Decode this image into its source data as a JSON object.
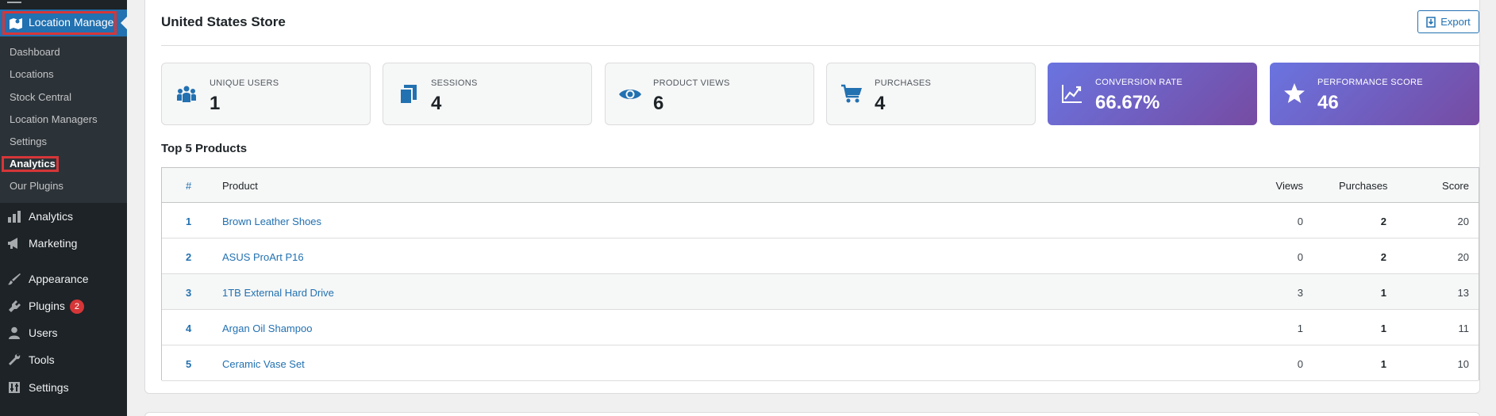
{
  "sidebar": {
    "active_menu": {
      "label": "Location Manage",
      "icon": "map-pin-icon"
    },
    "submenu": [
      {
        "label": "Dashboard"
      },
      {
        "label": "Locations"
      },
      {
        "label": "Stock Central"
      },
      {
        "label": "Location Managers"
      },
      {
        "label": "Settings"
      },
      {
        "label": "Analytics",
        "current": true
      },
      {
        "label": "Our Plugins"
      }
    ],
    "menu": [
      {
        "label": "Analytics",
        "icon": "bar-chart-icon"
      },
      {
        "label": "Marketing",
        "icon": "megaphone-icon"
      },
      {
        "label": "Appearance",
        "icon": "paintbrush-icon"
      },
      {
        "label": "Plugins",
        "icon": "plug-icon",
        "badge": "2"
      },
      {
        "label": "Users",
        "icon": "user-icon"
      },
      {
        "label": "Tools",
        "icon": "wrench-icon"
      },
      {
        "label": "Settings",
        "icon": "settings-icon"
      }
    ]
  },
  "header": {
    "title": "United States Store",
    "export_label": "Export"
  },
  "stats": [
    {
      "label": "UNIQUE USERS",
      "value": "1",
      "icon": "users-icon"
    },
    {
      "label": "SESSIONS",
      "value": "4",
      "icon": "copy-icon"
    },
    {
      "label": "PRODUCT VIEWS",
      "value": "6",
      "icon": "eye-icon"
    },
    {
      "label": "PURCHASES",
      "value": "4",
      "icon": "cart-icon"
    },
    {
      "label": "CONVERSION RATE",
      "value": "66.67%",
      "icon": "trend-icon"
    },
    {
      "label": "PERFORMANCE SCORE",
      "value": "46",
      "icon": "star-icon"
    }
  ],
  "top_products": {
    "title": "Top 5 Products",
    "columns": [
      "#",
      "Product",
      "Views",
      "Purchases",
      "Score"
    ],
    "rows": [
      {
        "rank": "1",
        "product": "Brown Leather Shoes",
        "views": "0",
        "purchases": "2",
        "score": "20"
      },
      {
        "rank": "2",
        "product": "ASUS ProArt P16",
        "views": "0",
        "purchases": "2",
        "score": "20"
      },
      {
        "rank": "3",
        "product": "1TB External Hard Drive",
        "views": "3",
        "purchases": "1",
        "score": "13"
      },
      {
        "rank": "4",
        "product": "Argan Oil Shampoo",
        "views": "1",
        "purchases": "1",
        "score": "11"
      },
      {
        "rank": "5",
        "product": "Ceramic Vase Set",
        "views": "0",
        "purchases": "1",
        "score": "10"
      }
    ]
  },
  "colors": {
    "sidebar_bg": "#1d2327",
    "accent": "#2271b1",
    "highlight": "#d63638",
    "gradient_start": "#6a74e0",
    "gradient_end": "#764ba2"
  }
}
